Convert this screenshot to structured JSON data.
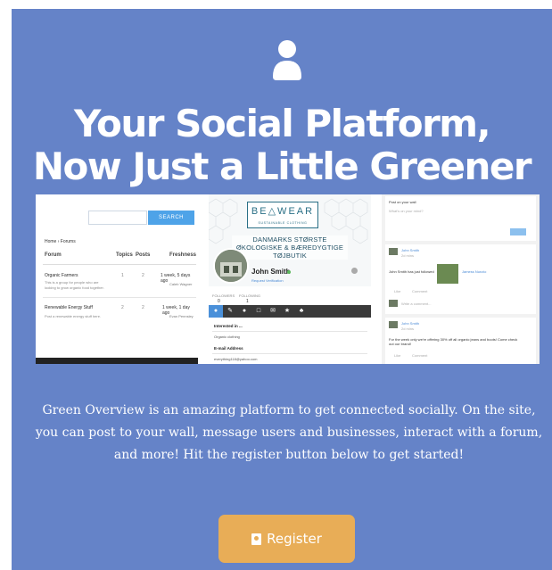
{
  "hero": {
    "title_line1": "Your Social Platform,",
    "title_line2": "Now Just a Little Greener",
    "description": "Green Overview is an amazing platform to get connected socially. On the site, you can post to your wall, message users and businesses, interact with a forum, and more! Hit the register button below to get started!",
    "register_label": "Register",
    "icon": "user-icon"
  },
  "forum": {
    "search_button": "SEARCH",
    "breadcrumb": "Home › Forums",
    "columns": [
      "Forum",
      "Topics",
      "Posts",
      "Freshness"
    ],
    "rows": [
      {
        "title": "Organic Farmers",
        "desc": "This is a group for people who are looking to grow organic food together.",
        "topics": "1",
        "posts": "2",
        "freshness": "1 week, 5 days ago",
        "user": "Caleb Wagner"
      },
      {
        "title": "Renewable Energy Stuff",
        "desc": "Post a renewable energy stuff here.",
        "topics": "2",
        "posts": "2",
        "freshness": "1 week, 1 day ago",
        "user": "Evan Pennsley"
      }
    ]
  },
  "profile": {
    "logo": "BE△WEAR",
    "logo_sub": "SUSTAINABLE CLOTHING",
    "banner": "DANMARKS STØRSTE ØKOLOGISKE & BÆREDYGTIGE TØJBUTIK",
    "name": "John Smith",
    "verify": "Request Verification",
    "followers_label": "FOLLOWERS",
    "followers": "0",
    "following_label": "FOLLOWING",
    "following": "1",
    "sections": [
      {
        "label": "Interested in ...",
        "value": "Organic clothing"
      },
      {
        "label": "E-mail Address",
        "value": "everything118@yahoo.com"
      }
    ]
  },
  "wall": {
    "post_title": "Post on your wall",
    "post_placeholder": "What's on your mind?",
    "author": "John Smith",
    "time": "2d mins",
    "shared_text": "John Smith has just followed",
    "shared_link": "Jamess Nunzio",
    "like": "Like",
    "comment": "Comment",
    "write_comment": "Write a comment...",
    "offer_text": "For the week only we're offering 30% off all organic jeans and boots! Come check out our brand!"
  },
  "colors": {
    "panel": "#6583c8",
    "button": "#e8ad57",
    "accent": "#4ea3e8"
  }
}
